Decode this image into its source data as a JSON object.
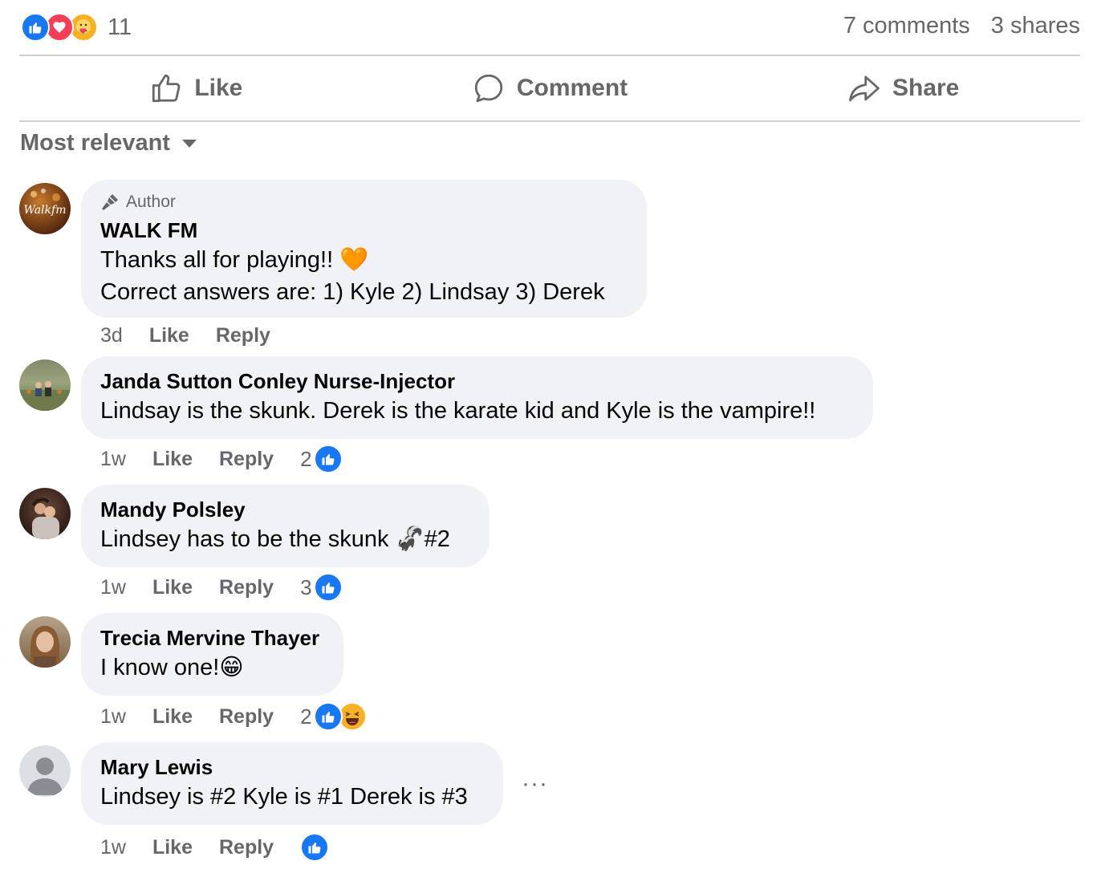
{
  "stats": {
    "reaction_count": "11",
    "comments": "7 comments",
    "shares": "3 shares",
    "reaction_icons": [
      "like-icon",
      "love-icon",
      "care-icon"
    ]
  },
  "actions": {
    "like": "Like",
    "comment": "Comment",
    "share": "Share"
  },
  "sort": {
    "label": "Most relevant"
  },
  "colors": {
    "accent": "#1877f2",
    "muted": "#65676b",
    "bubble": "#f0f2f5"
  },
  "comments": [
    {
      "author_tag": "Author",
      "name": "WALK FM",
      "avatar_text": "Walkfm",
      "lines": [
        "Thanks all for playing!! 🧡",
        "Correct answers are: 1) Kyle 2) Lindsay 3) Derek"
      ],
      "time": "3d",
      "like": "Like",
      "reply": "Reply"
    },
    {
      "name": "Janda Sutton Conley Nurse-Injector",
      "lines": [
        "Lindsay is the skunk. Derek is the karate kid and Kyle is the vampire!!"
      ],
      "time": "1w",
      "like": "Like",
      "reply": "Reply",
      "reaction_count": "2"
    },
    {
      "name": "Mandy Polsley",
      "lines": [
        "Lindsey has to be the skunk 🦨#2"
      ],
      "time": "1w",
      "like": "Like",
      "reply": "Reply",
      "reaction_count": "3"
    },
    {
      "name": "Trecia Mervine Thayer",
      "lines": [
        "I know one!😁"
      ],
      "time": "1w",
      "like": "Like",
      "reply": "Reply",
      "reaction_count": "2"
    },
    {
      "name": "Mary Lewis",
      "lines": [
        "Lindsey is #2 Kyle is #1 Derek is #3"
      ],
      "time": "1w",
      "like": "Like",
      "reply": "Reply",
      "more": "···"
    }
  ]
}
